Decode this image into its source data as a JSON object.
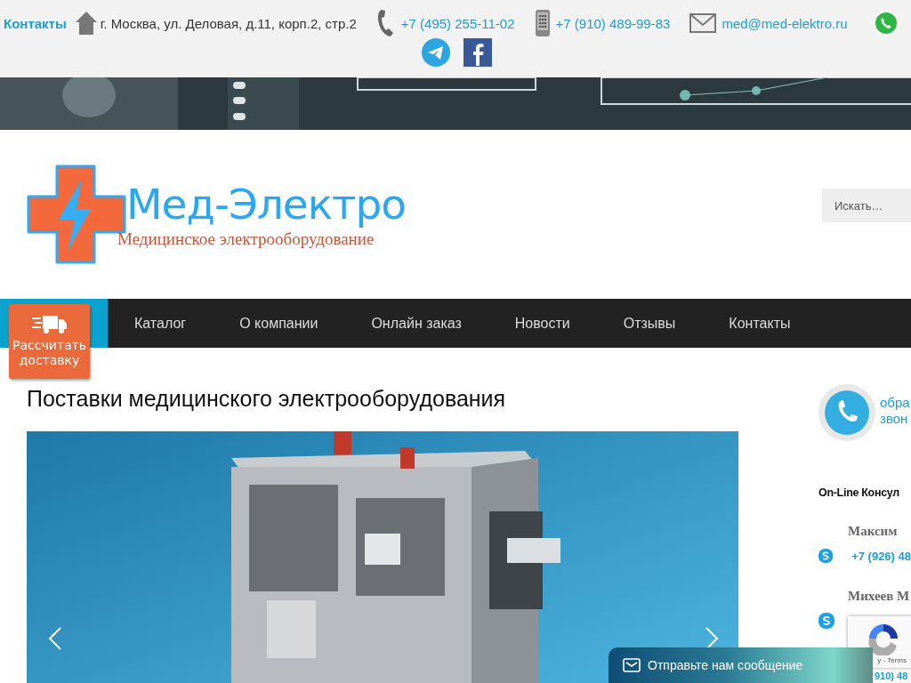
{
  "top_bar": {
    "contacts_label": "Контакты",
    "address": "г. Москва, ул. Деловая, д.11, корп.2, стр.2",
    "phone": "+7 (495) 255-11-02",
    "mobile": "+7 (910) 489-99-83",
    "email": "med@med-elektro.ru"
  },
  "logo": {
    "name": "Мед-Электро",
    "tagline": "Медицинское электрооборудование"
  },
  "search": {
    "placeholder": "Искать…"
  },
  "delivery_button": {
    "label": "Рассчитать доставку"
  },
  "nav": [
    {
      "label": "Каталог"
    },
    {
      "label": "О компании"
    },
    {
      "label": "Онлайн заказ"
    },
    {
      "label": "Новости"
    },
    {
      "label": "Отзывы"
    },
    {
      "label": "Контакты"
    }
  ],
  "page_title": "Поставки медицинского электрооборудования",
  "sidebar": {
    "callback_lines": [
      "обра",
      "звон"
    ],
    "consult_title": "On-Line Консул",
    "consultants": [
      {
        "name": "Максим",
        "phone": "+7 (926) 48"
      },
      {
        "name": "Михеев М",
        "phone": "910) 48"
      }
    ]
  },
  "recaptcha": {
    "text": "y - Terms"
  },
  "chat_bar": {
    "label": "Отправьте нам сообщение"
  }
}
